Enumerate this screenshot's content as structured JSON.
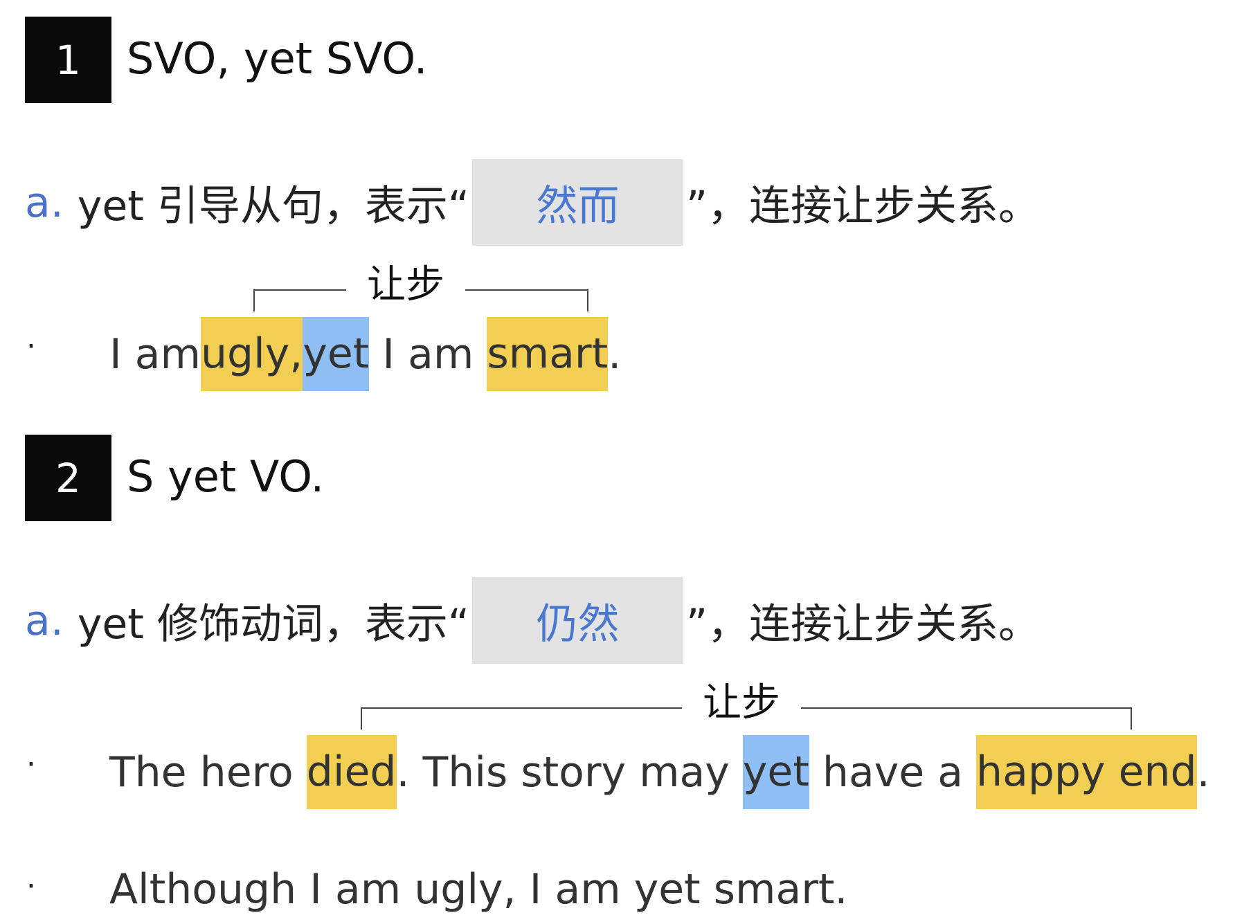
{
  "sections": [
    {
      "number": "1",
      "heading": "SVO, yet SVO.",
      "explanation": {
        "marker": "a.",
        "prefix": "yet 引导从句，表示“",
        "answer": "然而",
        "suffix": "”，连接让步关系。"
      },
      "bracket_label": "让步",
      "example": {
        "bullet": "·",
        "segments": [
          {
            "text": "I am ",
            "highlight": "none"
          },
          {
            "text": "ugly,",
            "highlight": "yellow"
          },
          {
            "text": " ",
            "highlight": "none"
          },
          {
            "text": "yet",
            "highlight": "blue"
          },
          {
            "text": " I am ",
            "highlight": "none"
          },
          {
            "text": "smart",
            "highlight": "yellow"
          },
          {
            "text": ".",
            "highlight": "none"
          }
        ]
      }
    },
    {
      "number": "2",
      "heading": "S yet VO.",
      "explanation": {
        "marker": "a.",
        "prefix": "yet 修饰动词，表示“",
        "answer": "仍然",
        "suffix": "”，连接让步关系。"
      },
      "bracket_label": "让步",
      "example": {
        "bullet": "·",
        "segments": [
          {
            "text": "The hero ",
            "highlight": "none"
          },
          {
            "text": "died",
            "highlight": "yellow"
          },
          {
            "text": ". This story may ",
            "highlight": "none"
          },
          {
            "text": "yet",
            "highlight": "blue"
          },
          {
            "text": " have a ",
            "highlight": "none"
          },
          {
            "text": "happy end",
            "highlight": "yellow"
          },
          {
            "text": ".",
            "highlight": "none"
          }
        ]
      },
      "extra_example": {
        "bullet": "·",
        "text": "Although I am ugly, I am yet smart."
      }
    }
  ],
  "colors": {
    "highlight_yellow": "#f2cf52",
    "highlight_blue": "#8fbff5",
    "answer_box": "#e3e3e3",
    "answer_text": "#4a78d0",
    "marker": "#4a72c8"
  }
}
